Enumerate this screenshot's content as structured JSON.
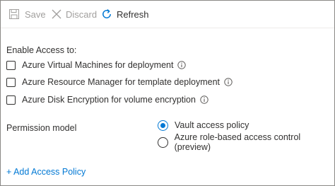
{
  "toolbar": {
    "save_label": "Save",
    "discard_label": "Discard",
    "refresh_label": "Refresh"
  },
  "access": {
    "heading": "Enable Access to:",
    "options": [
      {
        "label": "Azure Virtual Machines for deployment",
        "checked": false
      },
      {
        "label": "Azure Resource Manager for template deployment",
        "checked": false
      },
      {
        "label": "Azure Disk Encryption for volume encryption",
        "checked": false
      }
    ]
  },
  "permission": {
    "label": "Permission model",
    "options": [
      {
        "label": "Vault access policy",
        "selected": true
      },
      {
        "label": "Azure role-based access control (preview)",
        "selected": false
      }
    ]
  },
  "add_policy_link": "+ Add Access Policy",
  "colors": {
    "accent": "#0078d4",
    "disabled_text": "#a19f9d",
    "text": "#323130"
  },
  "icons": [
    "save-icon",
    "discard-icon",
    "refresh-icon",
    "info-icon"
  ]
}
